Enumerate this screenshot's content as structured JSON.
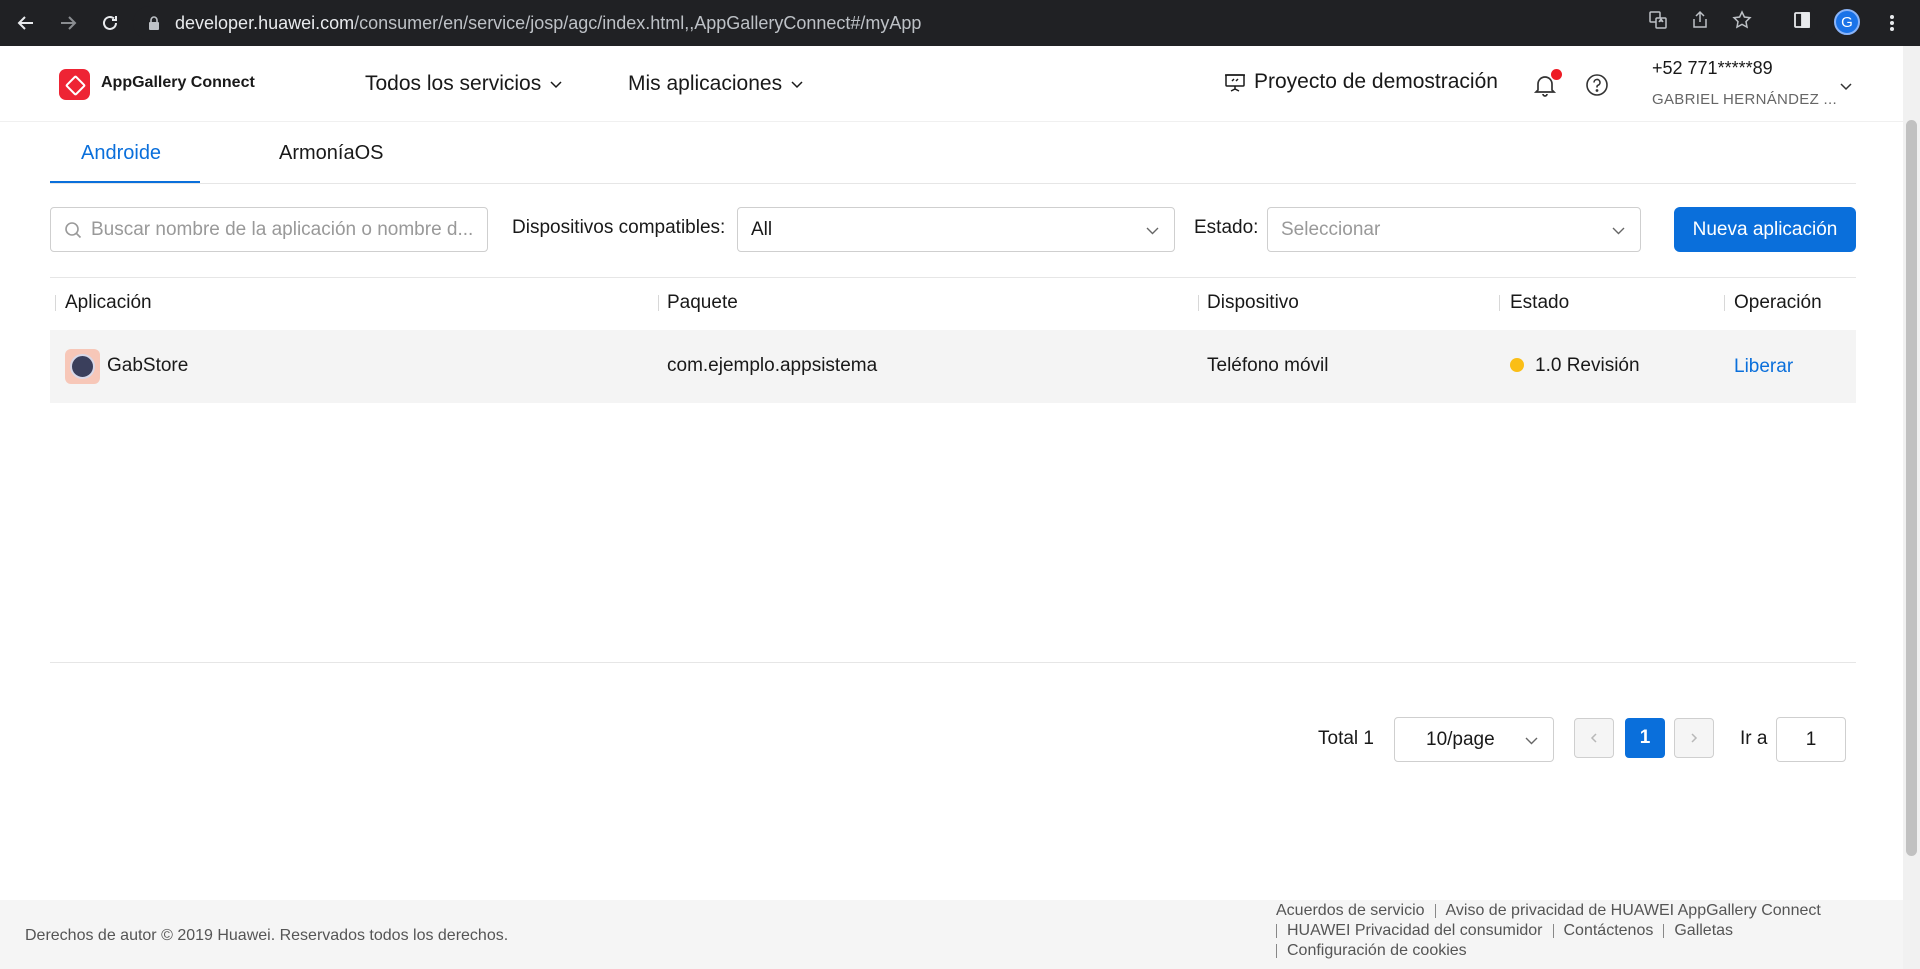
{
  "browser": {
    "url_host": "developer.huawei.com",
    "url_path": "/consumer/en/service/josp/agc/index.html,,AppGalleryConnect#/myApp",
    "profile_initial": "G"
  },
  "header": {
    "brand": "AppGallery Connect",
    "menu_all_services": "Todos los servicios",
    "menu_my_apps": "Mis aplicaciones",
    "demo_project": "Proyecto de demostración",
    "user_phone": "+52 771*****89",
    "user_name": "GABRIEL HERNÁNDEZ ..."
  },
  "tabs": [
    {
      "label": "Androide",
      "active": true
    },
    {
      "label": "ArmoníaOS",
      "active": false
    }
  ],
  "filters": {
    "search_placeholder": "Buscar nombre de la aplicación o nombre d...",
    "devices_label": "Dispositivos compatibles:",
    "devices_value": "All",
    "status_label": "Estado:",
    "status_placeholder": "Seleccionar",
    "new_app_button": "Nueva aplicación"
  },
  "table": {
    "columns": [
      "Aplicación",
      "Paquete",
      "Dispositivo",
      "Estado",
      "Operación"
    ],
    "rows": [
      {
        "app": "GabStore",
        "package": "com.ejemplo.appsistema",
        "device": "Teléfono móvil",
        "status": "1.0 Revisión",
        "status_color": "#fabe16",
        "operation": "Liberar"
      }
    ]
  },
  "pagination": {
    "total": "Total 1",
    "page_size": "10/page",
    "current_page": "1",
    "goto_label": "Ir a",
    "goto_value": "1"
  },
  "footer": {
    "copyright": "Derechos de autor © 2019 Huawei. Reservados todos los derechos.",
    "links": [
      "Acuerdos de servicio",
      "Aviso de privacidad de HUAWEI AppGallery Connect",
      "HUAWEI Privacidad del consumidor",
      "Contáctenos",
      "Galletas",
      "Configuración de cookies"
    ]
  },
  "colors": {
    "accent": "#0a6fdb",
    "brand_red": "#ee2434",
    "notification_dot": "#ee1c25"
  }
}
